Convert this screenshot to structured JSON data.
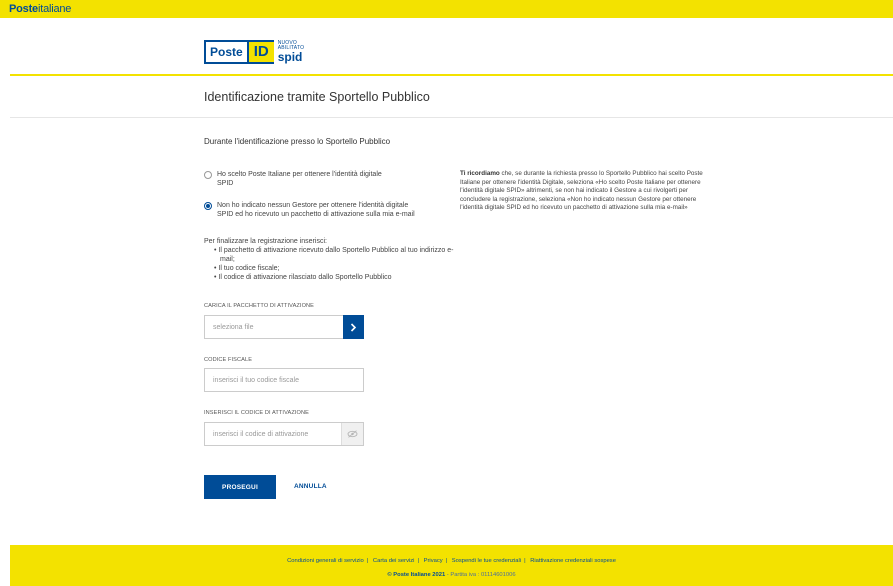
{
  "header": {
    "brand_bold": "Poste",
    "brand_light": "italiane"
  },
  "logo": {
    "poste": "Poste",
    "id": "ID",
    "nuovo": "NUOVO",
    "abilitato": "ABILITATO",
    "spid": "spid",
    "accent": "#f3e200",
    "brand_blue": "#004c97"
  },
  "page": {
    "title": "Identificazione tramite Sportello Pubblico",
    "subtitle": "Durante l'identificazione presso lo Sportello Pubblico"
  },
  "options": [
    {
      "label_line1": "Ho scelto Poste Italiane per ottenere l'identità digitale",
      "label_line2": "SPID",
      "selected": false
    },
    {
      "label_line1": "Non ho indicato nessun Gestore per ottenere l'identità digitale",
      "label_line2": "SPID ed ho ricevuto un pacchetto di attivazione sulla mia e-mail",
      "selected": true
    }
  ],
  "instructions": {
    "intro": "Per finalizzare la registrazione inserisci:",
    "items": [
      "Il pacchetto di attivazione ricevuto dallo Sportello Pubblico al tuo indirizzo e-mail;",
      "Il tuo codice fiscale;",
      "Il codice di attivazione rilasciato dallo Sportello Pubblico"
    ]
  },
  "form": {
    "package": {
      "label": "CARICA IL PACCHETTO DI ATTIVAZIONE",
      "placeholder": "seleziona file",
      "button_icon": "chevron-right-icon"
    },
    "fiscal_code": {
      "label": "CODICE FISCALE",
      "placeholder": "inserisci il tuo codice fiscale"
    },
    "activation_code": {
      "label": "INSERISCI IL CODICE DI ATTIVAZIONE",
      "placeholder": "inserisci il codice di attivazione",
      "toggle_icon": "eye-off-icon"
    }
  },
  "actions": {
    "continue_label": "PROSEGUI",
    "cancel_label": "ANNULLA"
  },
  "note": {
    "bold": "Ti ricordiamo",
    "text": " che, se durante la richiesta presso lo Sportello Pubblico hai scelto Poste Italiane per ottenere l'identità Digitale, seleziona «Ho scelto Poste Italiane per ottenere l'identità digitale SPID» altrimenti, se non hai indicato il Gestore a cui rivolgerti per concludere la registrazione, seleziona «Non ho indicato nessun Gestore per ottenere l'identità digitale SPID ed ho ricevuto un pacchetto di attivazione sulla mia e-mail»"
  },
  "footer": {
    "links": [
      "Condizioni generali di servizio",
      "Carta dei servizi",
      "Privacy",
      "Sospendi le tue credenziali",
      "Riattivazione credenziali sospese"
    ],
    "copyright": "© Poste Italiane 2021",
    "vat": " - Partita iva : 01114601006"
  }
}
